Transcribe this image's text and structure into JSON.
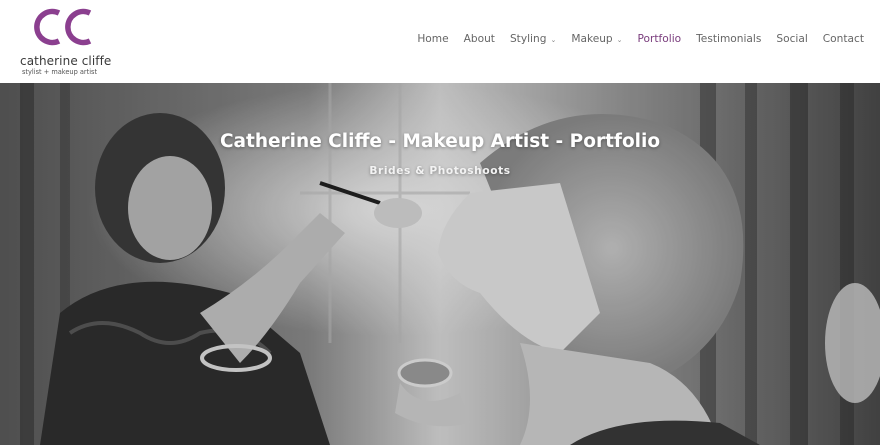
{
  "brand": {
    "monogram": "CC",
    "name": "catherine cliffe",
    "tagline": "stylist + makeup artist",
    "accent_color": "#8b3f8f"
  },
  "nav": {
    "items": [
      {
        "label": "Home"
      },
      {
        "label": "About"
      },
      {
        "label": "Styling",
        "dropdown": true
      },
      {
        "label": "Makeup",
        "dropdown": true
      },
      {
        "label": "Portfolio",
        "active": true
      },
      {
        "label": "Testimonials"
      },
      {
        "label": "Social"
      },
      {
        "label": "Contact"
      }
    ],
    "chevron_icon": "chevron-down-icon",
    "active_color": "#7a3d7d"
  },
  "hero": {
    "title": "Catherine Cliffe - Makeup Artist - Portfolio",
    "subtitle": "Brides & Photoshoots",
    "image_style": "black-and-white"
  }
}
